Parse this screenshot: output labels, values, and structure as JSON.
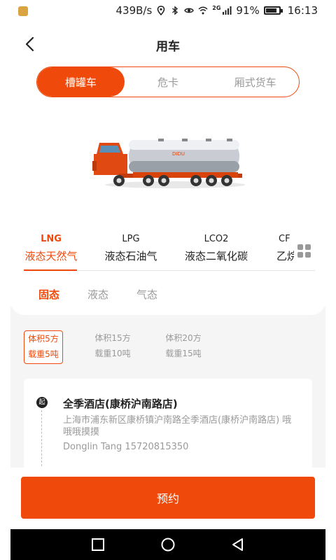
{
  "status_bar": {
    "net_speed": "439B/s",
    "network_type": "2G",
    "battery_text": "91%",
    "battery_level": 0.91,
    "time": "16:13"
  },
  "header": {
    "title": "用车"
  },
  "vehicle_tabs": [
    {
      "label": "槽罐车",
      "active": true
    },
    {
      "label": "危卡",
      "active": false
    },
    {
      "label": "厢式货车",
      "active": false
    }
  ],
  "truck": {
    "brand": "DIDU"
  },
  "gas_tabs": [
    {
      "code": "LNG",
      "name": "液态天然气",
      "active": true
    },
    {
      "code": "LPG",
      "name": "液态石油气",
      "active": false
    },
    {
      "code": "LCO2",
      "name": "液态二氧化碳",
      "active": false
    },
    {
      "code": "CF",
      "name": "乙烷",
      "active": false
    }
  ],
  "state_tabs": [
    {
      "label": "固态",
      "active": true
    },
    {
      "label": "液态",
      "active": false
    },
    {
      "label": "气态",
      "active": false
    }
  ],
  "specs": [
    {
      "volume": "体积5方",
      "load": "载重5吨",
      "active": true
    },
    {
      "volume": "体积15方",
      "load": "载重10吨",
      "active": false
    },
    {
      "volume": "体积20方",
      "load": "载重15吨",
      "active": false
    }
  ],
  "route": {
    "start_marker": "起",
    "place_name": "全季酒店(康桥沪南路店)",
    "address": "上海市浦东新区康桥镇沪南路全季酒店(康桥沪南路店) 哦哦哦摸摸",
    "contact": "Donglin Tang 15720815350"
  },
  "book_button": "预约",
  "colors": {
    "accent": "#ef4a0b",
    "muted": "#9a9a9a"
  }
}
